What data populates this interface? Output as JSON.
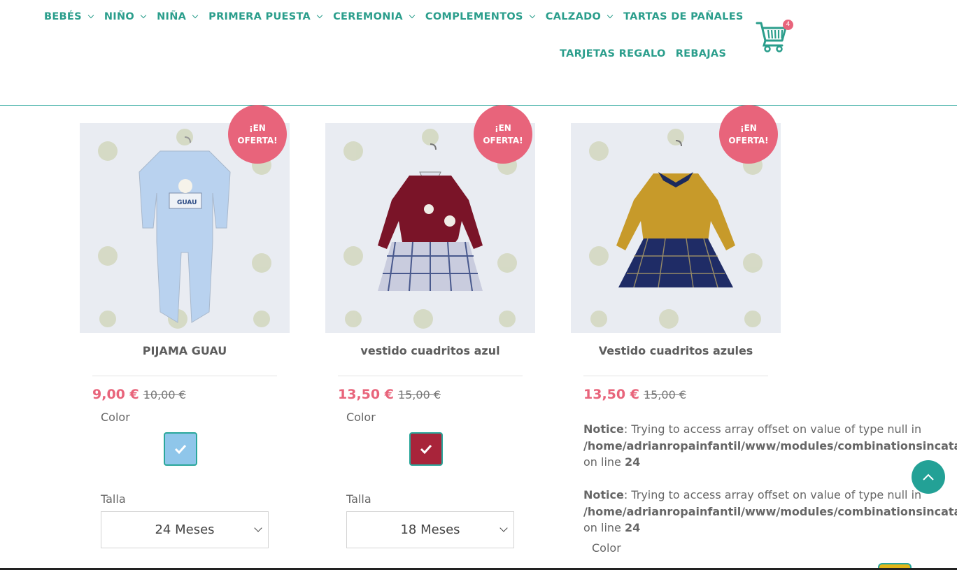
{
  "nav": {
    "row1": [
      {
        "label": "BEBÉS",
        "dropdown": true
      },
      {
        "label": "NIÑO",
        "dropdown": true
      },
      {
        "label": "NIÑA",
        "dropdown": true
      },
      {
        "label": "PRIMERA PUESTA",
        "dropdown": true
      },
      {
        "label": "CEREMONIA",
        "dropdown": true
      },
      {
        "label": "COMPLEMENTOS",
        "dropdown": true
      },
      {
        "label": "CALZADO",
        "dropdown": true
      },
      {
        "label": "TARTAS DE PAÑALES",
        "dropdown": false
      }
    ],
    "row2": [
      {
        "label": "TARJETAS REGALO",
        "dropdown": false
      },
      {
        "label": "REBAJAS",
        "dropdown": false
      }
    ],
    "cart_count": "4",
    "cart_icon": "shopping-cart-icon"
  },
  "colors": {
    "accent": "#2b9e8c",
    "sale": "#e8647b",
    "swatch_blue": "#8fc6ea",
    "swatch_burgundy": "#a8243a",
    "swatch_mustard": "#e2b619"
  },
  "products": [
    {
      "badge": "¡EN\nOFERTA!",
      "name": "PIJAMA GUAU",
      "price": "9,00 €",
      "old_price": "10,00 €",
      "color_label": "Color",
      "swatch_color": "#8fc6ea",
      "size_label": "Talla",
      "size_value": "24 Meses"
    },
    {
      "badge": "¡EN\nOFERTA!",
      "name": "vestido cuadritos azul",
      "price": "13,50 €",
      "old_price": "15,00 €",
      "color_label": "Color",
      "swatch_color": "#a8243a",
      "size_label": "Talla",
      "size_value": "18 Meses"
    },
    {
      "badge": "¡EN\nOFERTA!",
      "name": "Vestido cuadritos azules",
      "price": "13,50 €",
      "old_price": "15,00 €",
      "color_label": "Color"
    }
  ],
  "notices": [
    {
      "title": "Notice",
      "message": ": Trying to access array offset on value of type null in",
      "path": "/home/adrianropainfantil/www/modules/combinationsincatalo",
      "line_prefix": "on line ",
      "line": "24"
    },
    {
      "title": "Notice",
      "message": ": Trying to access array offset on value of type null in",
      "path": "/home/adrianropainfantil/www/modules/combinationsincatalo",
      "line_prefix": "on line ",
      "line": "24"
    }
  ]
}
